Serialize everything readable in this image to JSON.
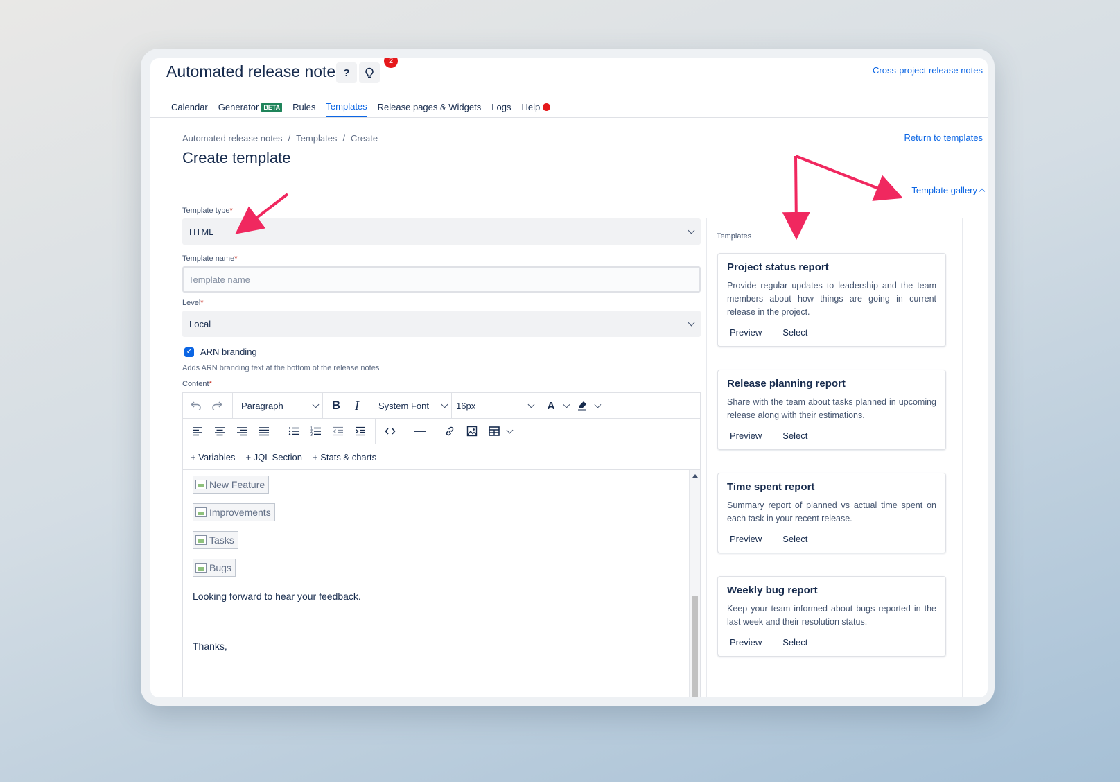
{
  "header": {
    "app_title": "Automated release notes",
    "help_icon_glyph": "?",
    "notification_count": "2",
    "cross_project_link": "Cross-project release notes"
  },
  "tabs": [
    {
      "label": "Calendar"
    },
    {
      "label": "Generator",
      "badge": "BETA"
    },
    {
      "label": "Rules"
    },
    {
      "label": "Templates",
      "active": true
    },
    {
      "label": "Release pages & Widgets"
    },
    {
      "label": "Logs"
    },
    {
      "label": "Help"
    }
  ],
  "breadcrumb": [
    "Automated release notes",
    "/",
    "Templates",
    "/",
    "Create"
  ],
  "page_title": "Create template",
  "return_link": "Return to templates",
  "gallery_link": "Template gallery",
  "form": {
    "template_type": {
      "label": "Template type",
      "value": "HTML"
    },
    "template_name": {
      "label": "Template name",
      "placeholder": "Template name",
      "value": ""
    },
    "level": {
      "label": "Level",
      "value": "Local"
    },
    "branding": {
      "label": "ARN branding",
      "checked": true,
      "helper": "Adds ARN branding text at the bottom of the release notes"
    },
    "content_label": "Content",
    "required_mark": "*"
  },
  "editor": {
    "block_format": "Paragraph",
    "font_family": "System Font",
    "font_size": "16px",
    "insert_links": [
      "+ Variables",
      "+ JQL Section",
      "+ Stats & charts"
    ],
    "images": [
      "New Feature",
      "Improvements",
      "Tasks",
      "Bugs"
    ],
    "paragraphs": [
      "Looking forward to hear your feedback.",
      "Thanks,"
    ]
  },
  "gallery": {
    "label": "Templates",
    "preview_label": "Preview",
    "select_label": "Select",
    "cards": [
      {
        "title": "Project status report",
        "description": "Provide regular updates to leadership and the team members about how things are going in current release in the project."
      },
      {
        "title": "Release planning report",
        "description": "Share with the team about tasks planned in upcoming release along with their estimations."
      },
      {
        "title": "Time spent report",
        "description": "Summary report of planned vs actual time spent on each task in your recent release."
      },
      {
        "title": "Weekly bug report",
        "description": "Keep your team informed about bugs reported in the last week and their resolution status."
      }
    ]
  },
  "colors": {
    "link": "#0c66e4",
    "text": "#172b4d",
    "badge_red": "#e5181b",
    "beta_green": "#1f845a",
    "annotation_arrow": "#f0285f"
  }
}
